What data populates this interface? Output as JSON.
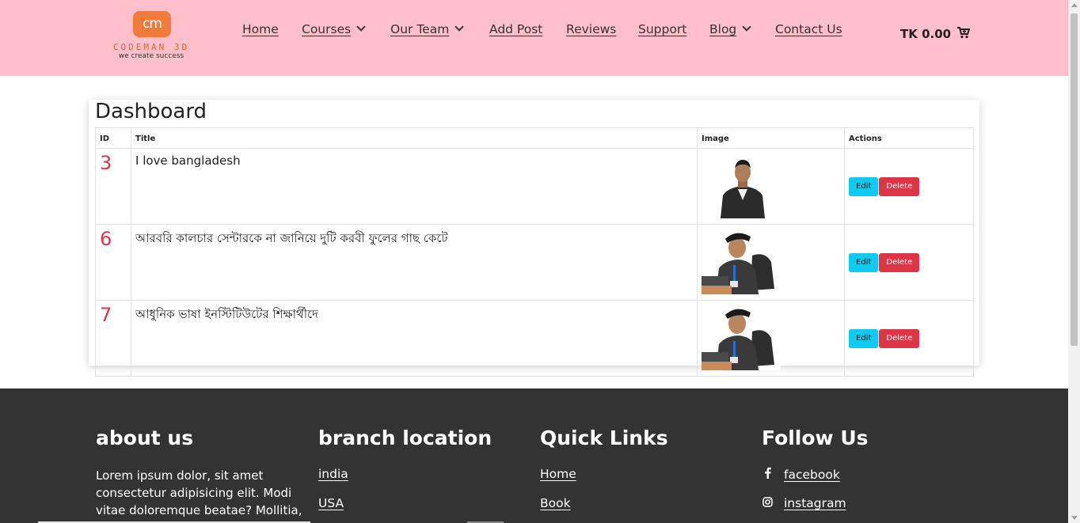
{
  "brand": {
    "logo_mark": "cm",
    "name": "CODEMAN 3D",
    "tagline": "we create success",
    "accent_color": "#f27b3c"
  },
  "nav": {
    "items": [
      {
        "label": "Home",
        "dropdown": false
      },
      {
        "label": "Courses",
        "dropdown": true
      },
      {
        "label": "Our Team",
        "dropdown": true
      },
      {
        "label": "Add Post",
        "dropdown": false
      },
      {
        "label": "Reviews",
        "dropdown": false
      },
      {
        "label": "Support",
        "dropdown": false
      },
      {
        "label": "Blog",
        "dropdown": true
      },
      {
        "label": "Contact Us",
        "dropdown": false
      }
    ],
    "cart_total": "TK 0.00",
    "cart_icon": "cart-icon",
    "header_color": "#ffc0cb"
  },
  "dashboard": {
    "title": "Dashboard",
    "columns": [
      "ID",
      "Title",
      "Image",
      "Actions"
    ],
    "rows": [
      {
        "id": "3",
        "title": "I love bangladesh",
        "image_icon": "person-photo-icon"
      },
      {
        "id": "6",
        "title": "আরবরি কালচার সেন্টারকে না জানিয়ে দুটি করবী ফুলের গাছ কেটে",
        "image_icon": "person-photo-icon"
      },
      {
        "id": "7",
        "title": "আধুনিক ভাষা ইনস্টিটিউটের শিক্ষার্থীদে",
        "image_icon": "person-photo-icon"
      }
    ],
    "edit_label": "Edit",
    "delete_label": "Delete",
    "edit_color": "#0dcaf0",
    "delete_color": "#dc3545"
  },
  "footer": {
    "background": "#333333",
    "about": {
      "title": "about us",
      "text": "Lorem ipsum dolor, sit amet consectetur adipisicing elit. Modi vitae doloremque beatae? Mollitia,"
    },
    "branch": {
      "title": "branch location",
      "links": [
        "india",
        "USA"
      ]
    },
    "quick": {
      "title": "Quick Links",
      "links": [
        "Home",
        "Book"
      ]
    },
    "follow": {
      "title": "Follow Us",
      "links": [
        {
          "label": "facebook",
          "icon": "facebook-icon"
        },
        {
          "label": "instagram",
          "icon": "instagram-icon"
        }
      ]
    }
  }
}
